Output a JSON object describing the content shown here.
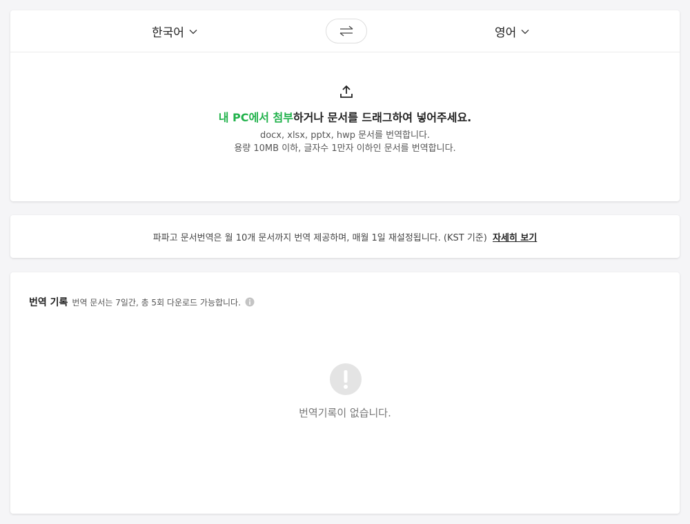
{
  "languages": {
    "source": "한국어",
    "target": "영어"
  },
  "upload": {
    "title_link": "내 PC에서 첨부",
    "title_rest": "하거나 문서를 드래그하여 넣어주세요.",
    "desc_formats": "docx, xlsx, pptx, hwp 문서를 번역합니다.",
    "desc_limits": "용량 10MB 이하, 글자수 1만자 이하인 문서를 번역합니다."
  },
  "notice": {
    "text": "파파고 문서번역은 월 10개 문서까지 번역 제공하며, 매월 1일 재설정됩니다. (KST 기준)",
    "link": "자세히 보기"
  },
  "history": {
    "title": "번역 기록",
    "subtitle": "번역 문서는 7일간, 총 5회 다운로드 가능합니다.",
    "empty": "번역기록이 없습니다."
  },
  "colors": {
    "accent_green": "#21b24b",
    "empty_icon_bg": "#e4e4e4"
  },
  "icons": [
    "chevron-down-icon",
    "swap-icon",
    "upload-icon",
    "info-icon",
    "alert-icon"
  ]
}
